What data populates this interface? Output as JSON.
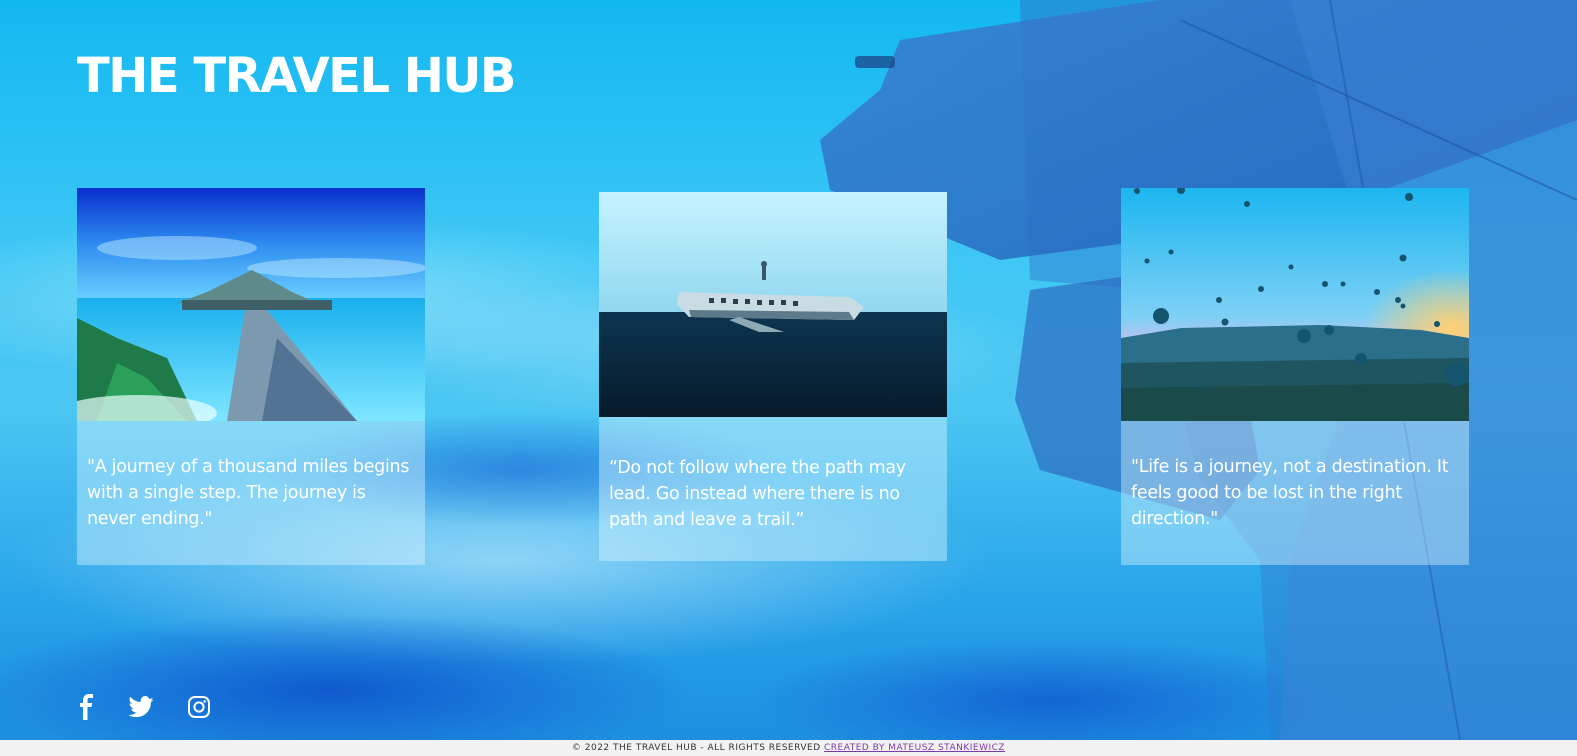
{
  "site": {
    "title": "THE TRAVEL HUB"
  },
  "cards": [
    {
      "image": "tropical-pier-photo",
      "quote": "\"A journey of a thousand miles begins with a single step. The journey is never ending.\""
    },
    {
      "image": "plane-wreck-photo",
      "quote": "“Do not follow where the path may lead. Go instead where there is no path and leave a trail.”"
    },
    {
      "image": "hot-air-balloons-photo",
      "quote": "\"Life is a journey, not a destination. It feels good to be lost in the right direction.\""
    }
  ],
  "social": [
    {
      "icon": "facebook-icon"
    },
    {
      "icon": "twitter-icon"
    },
    {
      "icon": "instagram-icon"
    }
  ],
  "footer": {
    "copyright": "© 2022 THE TRAVEL HUB - ALL RIGHTS RESERVED ",
    "credit_link": "CREATED BY MATEUSZ STANKIEWICZ"
  },
  "colors": {
    "accent": "#12b8f2",
    "text": "#ffffff",
    "link": "#7a3aa8"
  }
}
